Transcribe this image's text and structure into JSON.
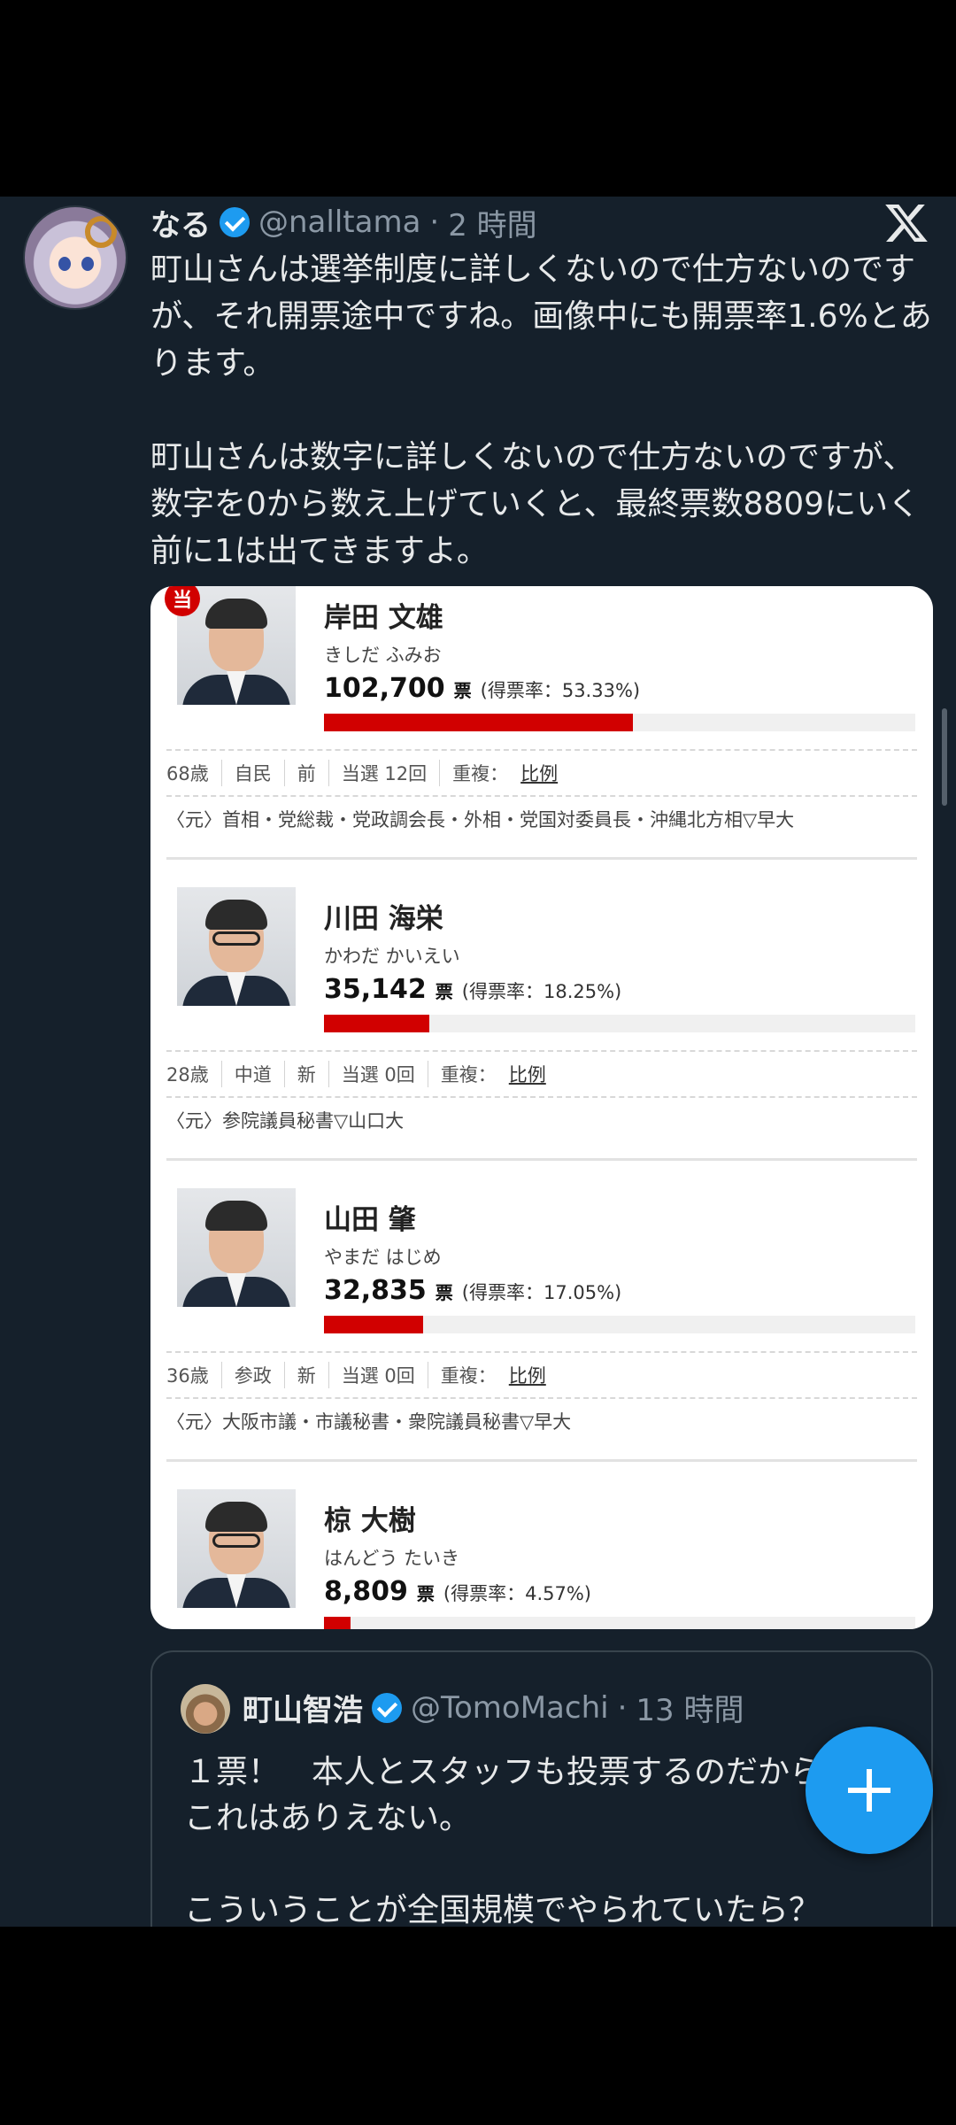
{
  "tweet": {
    "author_name": "なる",
    "handle": "@nalltama",
    "separator": "·",
    "time": "2 時間",
    "text": "町山さんは選挙制度に詳しくないので仕方ないのですが、それ開票途中ですね。画像中にも開票率1.6%とあります。\n\n町山さんは数字に詳しくないので仕方ないのですが、数字を0から数え上げていくと、最終票数8809にいく前に1は出てきますよ。",
    "verified": true,
    "platform_icon": "x-logo-icon"
  },
  "election_image": {
    "win_badge": "当",
    "vote_unit": "票",
    "candidates": [
      {
        "name": "岸田 文雄",
        "kana": "きしだ ふみお",
        "votes": "102,700",
        "rate": "(得票率：53.33%)",
        "share_percent": 53.33,
        "age": "68歳",
        "party": "自民",
        "status": "前",
        "wins": "当選 12回",
        "dup_label": "重複：",
        "dup_link": "比例",
        "career": "〈元〉首相・党総裁・党政調会長・外相・党国対委員長・沖縄北方相▽早大",
        "winner": true
      },
      {
        "name": "川田 海栄",
        "kana": "かわだ かいえい",
        "votes": "35,142",
        "rate": "(得票率：18.25%)",
        "share_percent": 18.25,
        "age": "28歳",
        "party": "中道",
        "status": "新",
        "wins": "当選 0回",
        "dup_label": "重複：",
        "dup_link": "比例",
        "career": "〈元〉参院議員秘書▽山口大",
        "winner": false
      },
      {
        "name": "山田 肇",
        "kana": "やまだ はじめ",
        "votes": "32,835",
        "rate": "(得票率：17.05%)",
        "share_percent": 17.05,
        "age": "36歳",
        "party": "参政",
        "status": "新",
        "wins": "当選 0回",
        "dup_label": "重複：",
        "dup_link": "比例",
        "career": "〈元〉大阪市議・市議秘書・衆院議員秘書▽早大",
        "winner": false
      },
      {
        "name": "椋 大樹",
        "kana": "はんどう たいき",
        "votes": "8,809",
        "rate": "(得票率：4.57%)",
        "share_percent": 4.57,
        "winner": false
      }
    ]
  },
  "quoted_tweet": {
    "author_name": "町山智浩",
    "handle": "@TomoMachi",
    "separator": "·",
    "time": "13 時間",
    "text": "１票！　本人とスタッフも投票するのだから\nこれはありえない。\n\nこういうことが全国規模でやられていたら？",
    "verified": true
  },
  "compose_button": {
    "icon": "plus-icon"
  },
  "colors": {
    "background": "#15202b",
    "accent": "#1d9bf0",
    "bar_red": "#d10000",
    "muted_text": "#8b98a5"
  }
}
